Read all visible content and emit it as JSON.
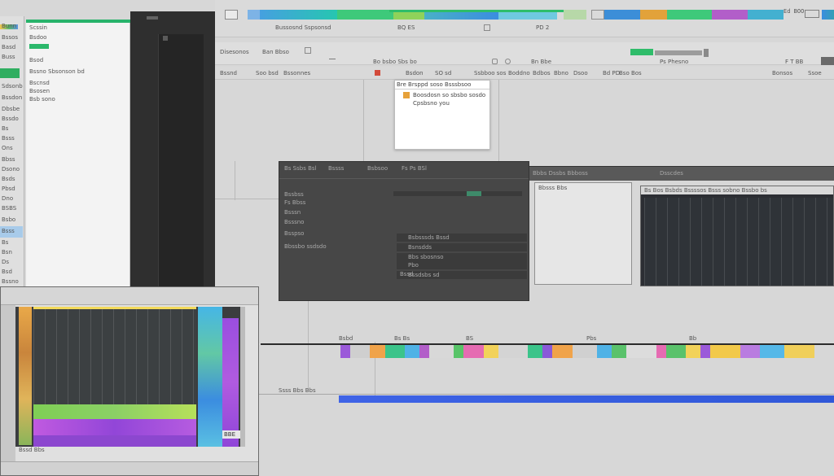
{
  "colors": {
    "app_bg": "#d7d7d7",
    "toolbar_bg": "#dadada",
    "dark_panel": "#474747",
    "dark_sidebar": "#2f2f2f",
    "accent_green": "#27ae60",
    "accent_blue": "#2f5fe0",
    "accent_orange": "#e8a23a"
  },
  "top_toolbar": {
    "text_a": "Bussosnd Sspsonsd",
    "text_b": "Ed BOO",
    "text_c": "BQ ES",
    "text_d": "PD 2",
    "text_e": "Sipuds"
  },
  "row2": {
    "left_label": "Disesonos",
    "mid_label": "Ban Bbso",
    "center_label": "Bo bsbo Sbs bo",
    "right_a": "Bn Bbe",
    "right_b": "Ps Phesno",
    "right_c": "F  T  BB"
  },
  "row3": {
    "items": [
      "Bssnd",
      "Soo bsd",
      "Bssonnes",
      "Bsdon",
      "SO sd",
      "Ssbboo sos",
      "Boddno",
      "Bdbos",
      "Bbno",
      "Dsoo",
      "Bd PD",
      "Bso Bos",
      "Bonsos",
      "Ssoe",
      "Diso"
    ]
  },
  "left_sidebar": {
    "lines": [
      "Bunn",
      "Bssos",
      "Basd",
      "Buss",
      "Blos sonos",
      "Sdsonb",
      "Bssdon",
      "Dbsbe",
      "Bssdo",
      "Bs",
      "Bsss",
      "Ons",
      "Bbss",
      "Dsono",
      "Bsds",
      "Pbsd",
      "Dno",
      "BSBS",
      "Bsbo",
      "Bsss",
      "Bs",
      "Bsn",
      "Ds",
      "Bsd",
      "Bssno",
      "BSs"
    ]
  },
  "white_panel": {
    "items": [
      "Scssin",
      "Bsdoo",
      "Bsod",
      "Bscnsd",
      "Bsosen",
      "Bsb sono",
      "Bssno Sbsonson bd",
      "Scnsdoo",
      "Bsnsbno"
    ]
  },
  "popup": {
    "title": "Bre Brsppd soso Bsssbsoo",
    "line1": "Boosdosn so sbsbo sosdo",
    "line2": "Cpsbsno you"
  },
  "dark_window": {
    "header_a": "Bs Ssbs Bsl",
    "header_b": "Bssss",
    "header_c": "Bsbsoo",
    "header_d": "Fs Ps BSl",
    "rows": [
      "Bssbss",
      "Fs Bbss",
      "Bsssn",
      "Bsssno",
      "Bsspso",
      "Bbssbo ssdsdo"
    ],
    "list": [
      "Bsbsssds Bssd",
      "Bsnsdds",
      "Bbs sbosnso",
      "Pbo",
      "Bssdsbs sd"
    ],
    "footer": "Bssd"
  },
  "right_pair": {
    "title": "Bbbs Dssbs Bbboss",
    "title_b": "Dsscdes",
    "left_pane": "Bbsss Bbs",
    "right_pane": "Bs Bos Bsbds Bssssos Bsss sobno Bssbo bs"
  },
  "timeline": {
    "labels": [
      "Bsbd",
      "Bs Bs",
      "BS",
      "Pbs",
      "Bb"
    ],
    "bottom_label": "Ssss Bbs Bbs"
  },
  "bottom_left": {
    "badge": "BBE",
    "footer": "Bssd Bbs"
  }
}
